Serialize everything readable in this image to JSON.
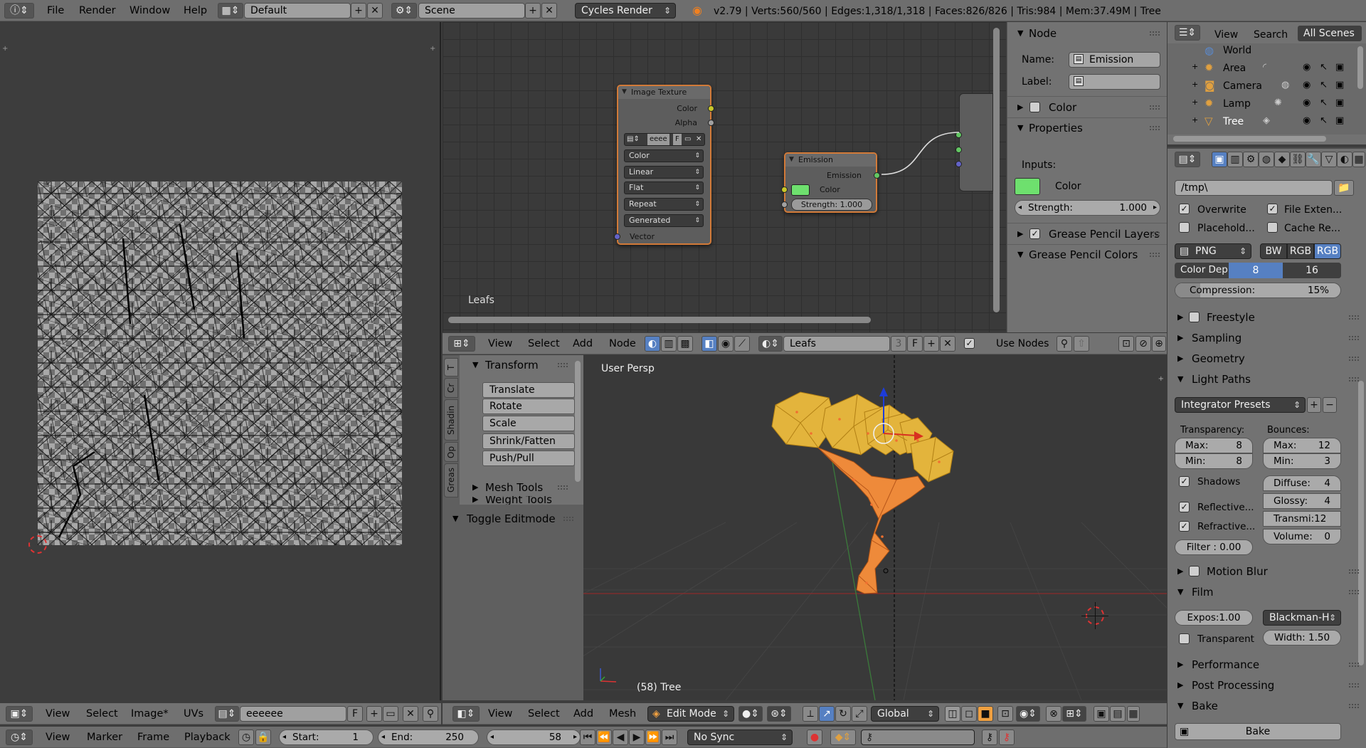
{
  "topbar": {
    "menus": [
      "File",
      "Render",
      "Window",
      "Help"
    ],
    "layout": "Default",
    "scene": "Scene",
    "engine": "Cycles Render",
    "stats": "v2.79 | Verts:560/560 | Edges:1,318/1,318 | Faces:826/826 | Tris:984 | Mem:37.49M | Tree"
  },
  "uv_editor": {
    "menus": [
      "View",
      "Select",
      "Image*",
      "UVs"
    ],
    "image_name": "eeeeee",
    "f_label": "F"
  },
  "node_editor": {
    "frame_label": "Leafs",
    "image_texture": {
      "title": "Image Texture",
      "outputs": [
        "Color",
        "Alpha"
      ],
      "image": "eeee",
      "f_label": "F",
      "selects": [
        "Color",
        "Linear",
        "Flat",
        "Repeat",
        "Generated"
      ],
      "input": "Vector"
    },
    "emission": {
      "title": "Emission",
      "output": "Emission",
      "color_label": "Color",
      "strength": "Strength: 1.000"
    },
    "header": {
      "menus": [
        "View",
        "Select",
        "Add",
        "Node"
      ],
      "material": "Leafs",
      "users": "3",
      "f_label": "F",
      "use_nodes": "Use Nodes"
    }
  },
  "node_props": {
    "section": "Node",
    "name_label": "Name:",
    "name_value": "Emission",
    "label_label": "Label:",
    "color_section": "Color",
    "properties_section": "Properties",
    "inputs_label": "Inputs:",
    "input_color_label": "Color",
    "input_color": "#6ee06e",
    "strength_label": "Strength:",
    "strength_value": "1.000",
    "gp_layers": "Grease Pencil Layers",
    "gp_colors": "Grease Pencil Colors"
  },
  "viewport": {
    "view_label": "User Persp",
    "object_label": "(58) Tree",
    "header": {
      "menus": [
        "View",
        "Select",
        "Add",
        "Mesh"
      ],
      "mode": "Edit Mode",
      "orientation": "Global"
    }
  },
  "toolshelf": {
    "tabs": [
      "T",
      "Cr",
      "Shadin",
      "Op",
      "Greas"
    ],
    "transform_title": "Transform",
    "tools": [
      "Translate",
      "Rotate",
      "Scale",
      "Shrink/Fatten",
      "Push/Pull"
    ],
    "mesh_tools": "Mesh Tools",
    "weight_tools": "Weight Tools",
    "toggle_editmode": "Toggle Editmode"
  },
  "outliner": {
    "menus": [
      "View",
      "Search"
    ],
    "filter": "All Scenes",
    "items": [
      "World",
      "Area",
      "Camera",
      "Lamp",
      "Tree"
    ]
  },
  "render_props": {
    "path": "/tmp\\",
    "overwrite": "Overwrite",
    "file_ext": "File Exten...",
    "placeholder": "Placehold...",
    "cache": "Cache Re...",
    "format": "PNG",
    "color_modes": [
      "BW",
      "RGB",
      "RGB"
    ],
    "color_depth_label": "Color Dep",
    "color_depths": [
      "8",
      "16"
    ],
    "compression_label": "Compression:",
    "compression_value": "15%",
    "freestyle": "Freestyle",
    "sampling": "Sampling",
    "geometry": "Geometry",
    "light_paths": "Light Paths",
    "integrator_presets": "Integrator Presets",
    "transparency_label": "Transparency:",
    "bounces_label": "Bounces:",
    "t_max": "Max:",
    "t_max_v": "8",
    "t_min": "Min:",
    "t_min_v": "8",
    "b_max": "Max:",
    "b_max_v": "12",
    "b_min": "Min:",
    "b_min_v": "3",
    "shadows": "Shadows",
    "reflective": "Reflective...",
    "refractive": "Refractive...",
    "diffuse": "Diffuse:",
    "diffuse_v": "4",
    "glossy": "Glossy:",
    "glossy_v": "4",
    "transmi": "Transmi:12",
    "volume": "Volume:",
    "volume_v": "0",
    "filter": "Filter : 0.00",
    "motion_blur": "Motion Blur",
    "film": "Film",
    "exposure": "Expos:1.00",
    "filter_type": "Blackman-H",
    "transparent": "Transparent",
    "width": "Width: 1.50",
    "performance": "Performance",
    "post_processing": "Post Processing",
    "bake": "Bake",
    "bake_button": "Bake"
  },
  "timeline": {
    "menus": [
      "View",
      "Marker",
      "Frame",
      "Playback"
    ],
    "start_label": "Start:",
    "start": "1",
    "end_label": "End:",
    "end": "250",
    "frame": "58",
    "sync": "No Sync"
  },
  "colors": {
    "accent": "#5680c2",
    "node_border": "#d27a38",
    "tree_leaf": "#e3b43c",
    "tree_trunk": "#ee8a3a"
  }
}
